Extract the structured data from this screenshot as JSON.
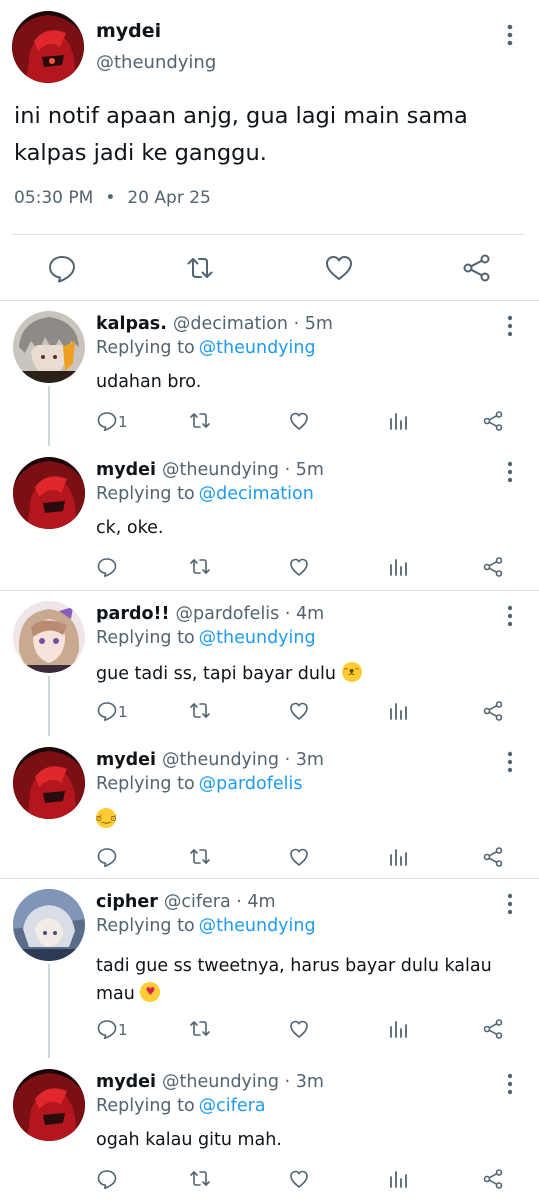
{
  "main_tweet": {
    "name": "mydei",
    "handle": "@theundying",
    "text": "ini notif apaan anjg, gua lagi main sama kalpas jadi ke ganggu.",
    "time": "05:30 PM",
    "separator": "•",
    "date": "20 Apr 25"
  },
  "icons": {
    "reply": "comment-bubble-icon",
    "retweet": "retweet-icon",
    "like": "heart-icon",
    "views": "bar-chart-icon",
    "share": "share-icon",
    "more": "more-vertical-icon"
  },
  "colors": {
    "link": "#1d9bf0",
    "muted": "#536471",
    "divider": "#dde3e7"
  },
  "threads": [
    {
      "replies": [
        {
          "name": "kalpas.",
          "handle": "@decimation",
          "time": "· 5m",
          "replying_label": "Replying to",
          "replying_to": "@theundying",
          "text": "udahan bro.",
          "reply_count": "1",
          "emoji": ""
        },
        {
          "name": "mydei",
          "handle": "@theundying",
          "time": "· 5m",
          "replying_label": "Replying to",
          "replying_to": "@decimation",
          "text": "ck, oke.",
          "reply_count": "",
          "emoji": ""
        }
      ]
    },
    {
      "replies": [
        {
          "name": "pardo!!",
          "handle": "@pardofelis",
          "time": "· 4m",
          "replying_label": "Replying to",
          "replying_to": "@theundying",
          "text": "gue tadi ss, tapi bayar dulu",
          "reply_count": "1",
          "emoji": "smirk-cat-emoji"
        },
        {
          "name": "mydei",
          "handle": "@theundying",
          "time": "· 3m",
          "replying_label": "Replying to",
          "replying_to": "@pardofelis",
          "text": "",
          "reply_count": "",
          "emoji": "raised-eyebrow-face-emoji"
        }
      ]
    },
    {
      "replies": [
        {
          "name": "cipher",
          "handle": "@cifera",
          "time": "· 4m",
          "replying_label": "Replying to",
          "replying_to": "@theundying",
          "text": "tadi gue ss tweetnya, harus bayar dulu kalau mau",
          "reply_count": "1",
          "emoji": "kissing-heart-face-emoji"
        },
        {
          "name": "mydei",
          "handle": "@theundying",
          "time": "· 3m",
          "replying_label": "Replying to",
          "replying_to": "@cifera",
          "text": "ogah kalau gitu mah.",
          "reply_count": "",
          "emoji": ""
        }
      ]
    }
  ]
}
